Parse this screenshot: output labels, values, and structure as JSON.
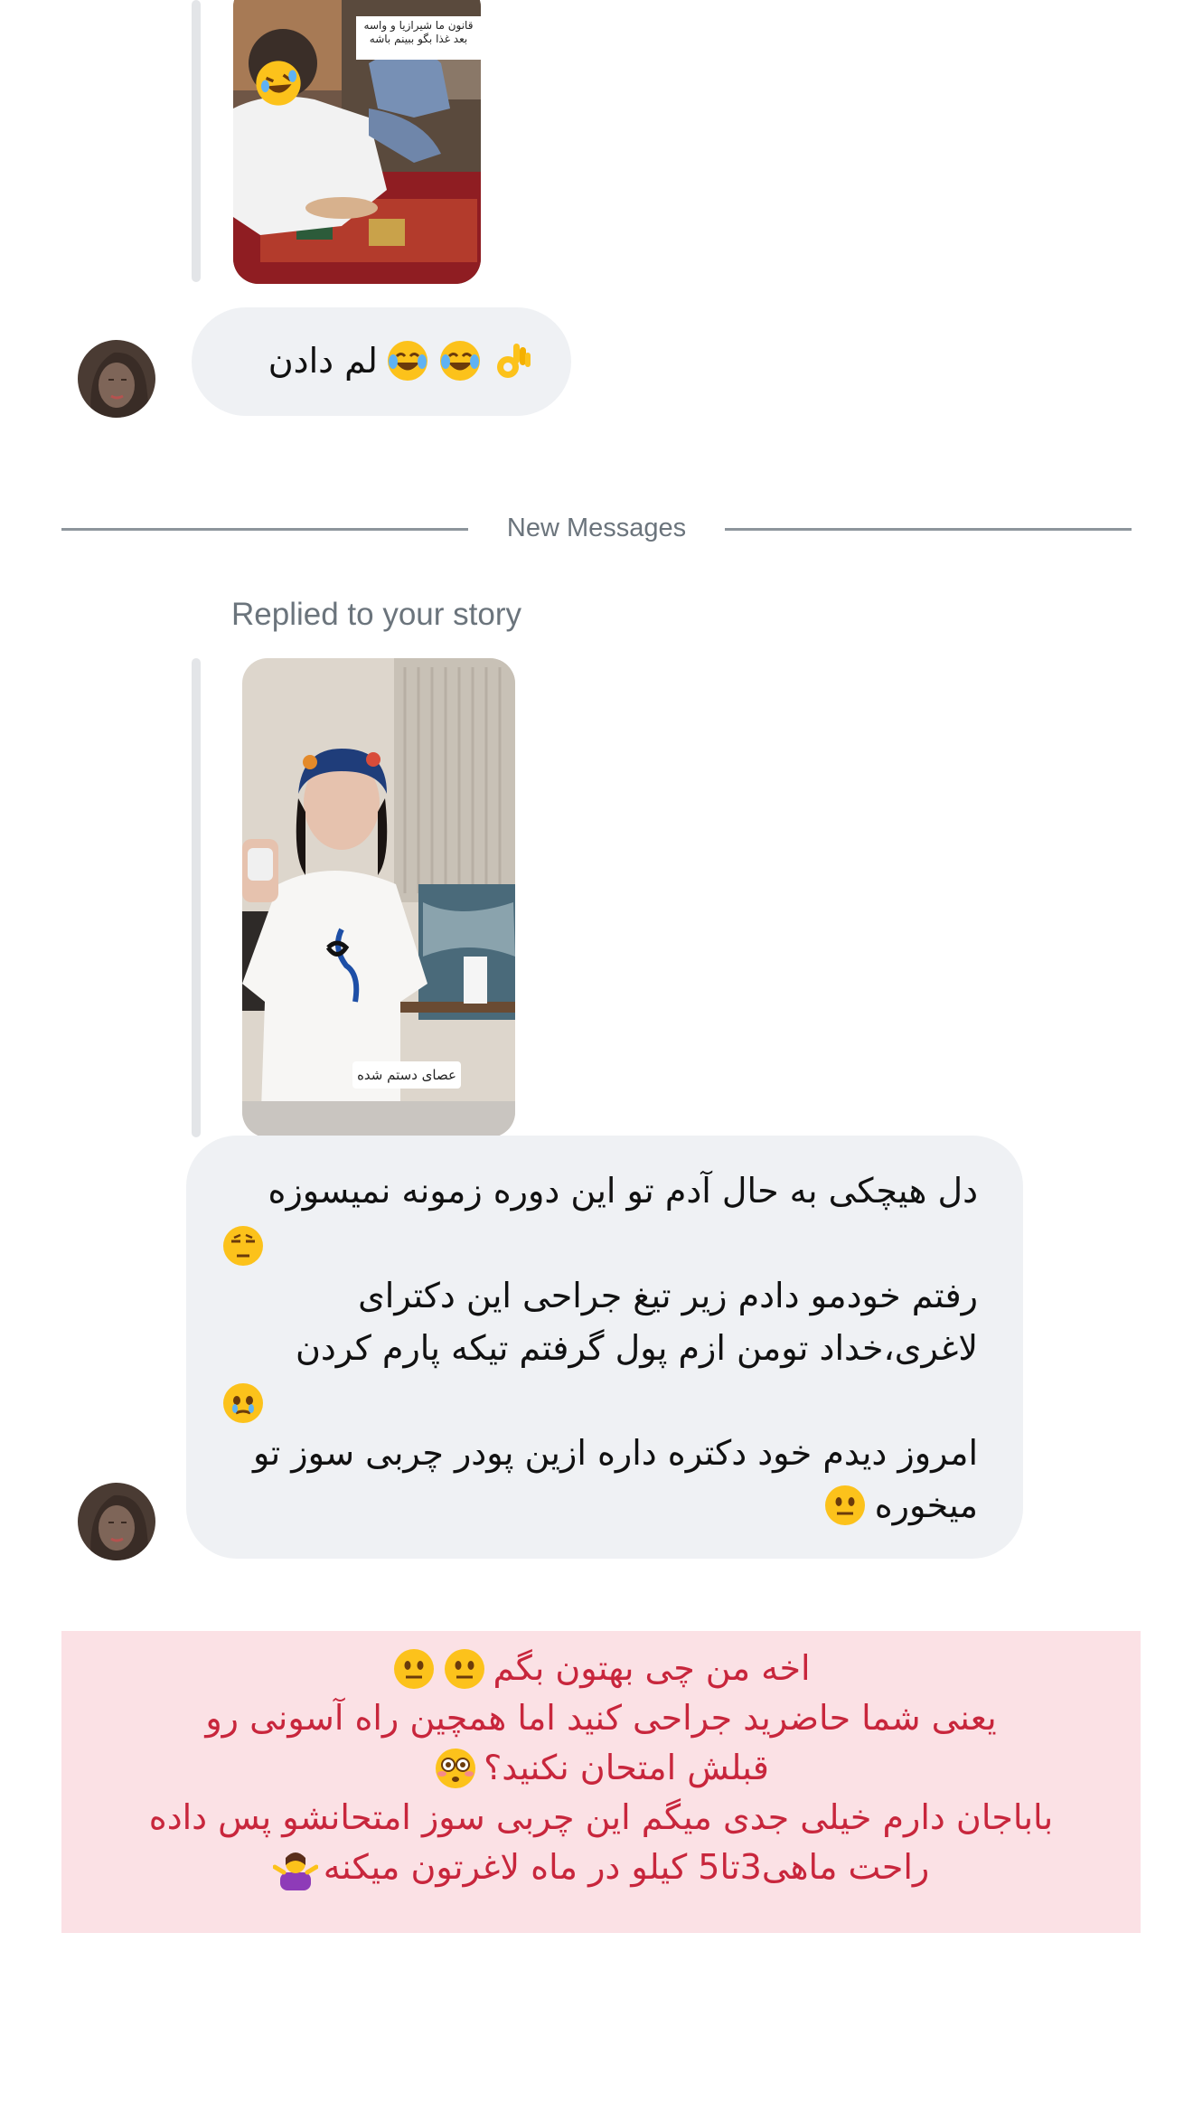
{
  "thread": {
    "top_story": {
      "sticker_text": "قانون ما شیرازیا و واسه بعد غذا بگو ببینم باشه"
    },
    "message_1": {
      "text": "لم دادن",
      "emojis": [
        "laughing-tears-emoji",
        "laughing-tears-emoji",
        "ok-hand-emoji"
      ]
    },
    "divider": {
      "label": "New Messages"
    },
    "reply_context": {
      "label": "Replied to your story"
    },
    "reply_story": {
      "sticker_text": "عصای دستم شده"
    },
    "message_2": {
      "line_1": "دل هیچکی به حال آدم تو این دوره زمونه نمیسوزه",
      "line_2": "رفتم خودمو دادم زیر تیغ جراحی این دکترای",
      "line_3": "لاغری،خداد تومن ازم پول گرفتم تیکه پارم کردن",
      "line_4": "امروز دیدم خود دکتره داره ازین پودر چربی سوز تو",
      "line_5": "میخوره"
    }
  },
  "caption": {
    "line_1": "اخه من چی بهتون بگم",
    "line_2": "یعنی شما حاضرید جراحی کنید اما همچین راه آسونی رو",
    "line_3": "قبلش امتحان نکنید؟",
    "line_4": "باباجان دارم خیلی جدی میگم این چربی سوز امتحانشو پس داده",
    "line_5": "راحت ماهی3تا5 کیلو در ماه لاغرتون میکنه"
  },
  "colors": {
    "bubble": "#eff1f4",
    "caption_bg": "#fbe1e5",
    "caption_text": "#c8263c",
    "divider": "#8d959c",
    "muted_text": "#6b747c"
  }
}
